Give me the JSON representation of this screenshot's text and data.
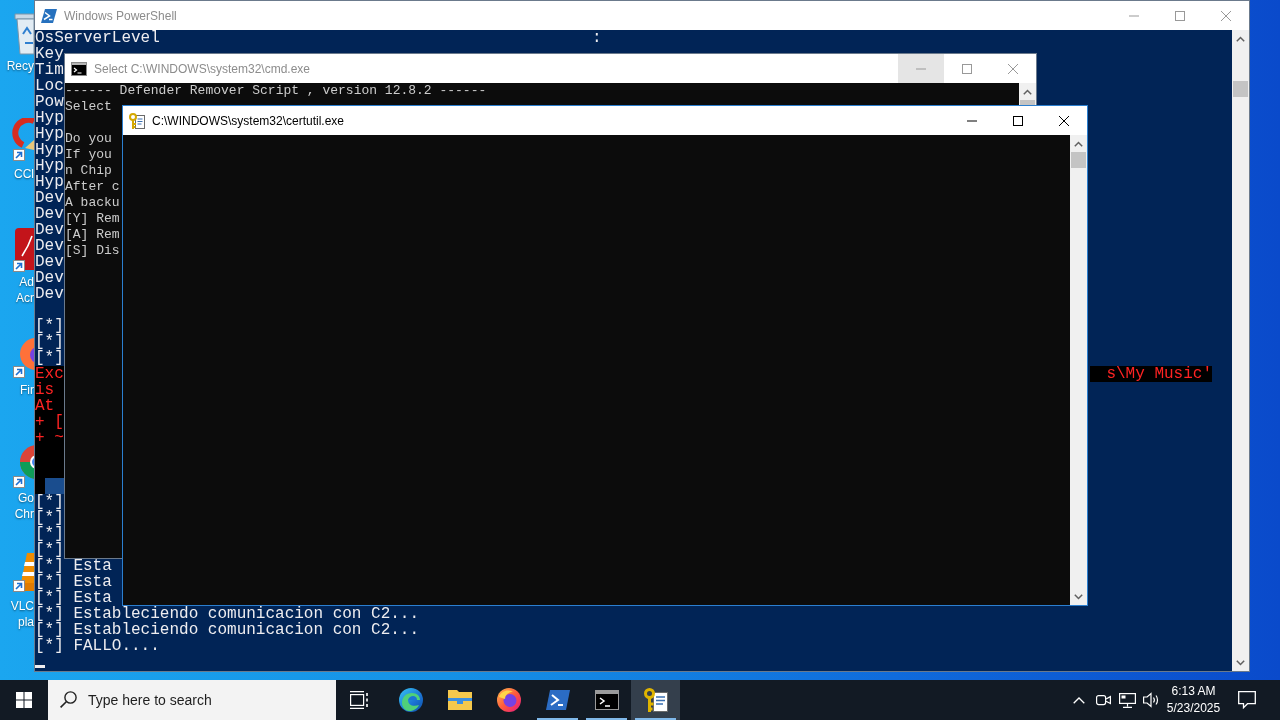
{
  "desktop": {
    "icons": [
      {
        "kind": "recycle_bin",
        "label": [
          "Recy"
        ]
      },
      {
        "kind": "cleaner",
        "label": [
          "CCl"
        ]
      },
      {
        "kind": "pdf_reader",
        "label": [
          "Ad",
          "Acr"
        ]
      },
      {
        "kind": "firefox",
        "label": [
          "Fir"
        ]
      },
      {
        "kind": "chrome",
        "label": [
          "Go",
          "Chr"
        ]
      },
      {
        "kind": "vlc",
        "label": [
          "VLC",
          "pla"
        ]
      }
    ]
  },
  "windows": [
    {
      "kind": "powershell",
      "title": "Windows PowerShell",
      "active": false,
      "controls": [
        {
          "kind": "minimize",
          "hovered": false
        },
        {
          "kind": "maximize",
          "hovered": false
        },
        {
          "kind": "close",
          "hovered": false
        }
      ],
      "lines": [
        {
          "kind": "text",
          "text": "OsServerLevel",
          "value": ":"
        },
        {
          "kind": "text",
          "text": "Key"
        },
        {
          "kind": "text",
          "text": "Tim"
        },
        {
          "kind": "text",
          "text": "Loc"
        },
        {
          "kind": "text",
          "text": "Pow"
        },
        {
          "kind": "text",
          "text": "Hyp"
        },
        {
          "kind": "text",
          "text": "Hyp"
        },
        {
          "kind": "text",
          "text": "Hyp"
        },
        {
          "kind": "text",
          "text": "Hyp"
        },
        {
          "kind": "text",
          "text": "Hyp"
        },
        {
          "kind": "text",
          "text": "Dev"
        },
        {
          "kind": "text",
          "text": "Dev"
        },
        {
          "kind": "text",
          "text": "Dev"
        },
        {
          "kind": "text",
          "text": "Dev"
        },
        {
          "kind": "text",
          "text": "Dev"
        },
        {
          "kind": "text",
          "text": "Dev"
        },
        {
          "kind": "text",
          "text": "Dev"
        },
        {
          "kind": "blank"
        },
        {
          "kind": "text",
          "text": "[*]"
        },
        {
          "kind": "text",
          "text": "[*]"
        },
        {
          "kind": "text",
          "text": "[*]"
        },
        {
          "kind": "error",
          "text": "Exc",
          "tail": "s\\My Music'"
        },
        {
          "kind": "error",
          "text": "is"
        },
        {
          "kind": "error",
          "text": "At"
        },
        {
          "kind": "error",
          "text": "+ ["
        },
        {
          "kind": "error",
          "text": "+ ~"
        },
        {
          "kind": "error"
        },
        {
          "kind": "error"
        },
        {
          "kind": "highlight"
        },
        {
          "kind": "text",
          "text": "[*]"
        },
        {
          "kind": "text",
          "text": "[*]"
        },
        {
          "kind": "text",
          "text": "[*]"
        },
        {
          "kind": "text",
          "text": "[*]"
        },
        {
          "kind": "text",
          "text": "[*] Esta"
        },
        {
          "kind": "text",
          "text": "[*] Esta"
        },
        {
          "kind": "text",
          "text": "[*] Esta"
        },
        {
          "kind": "text",
          "text": "[*] Estableciendo comunicacion con C2..."
        },
        {
          "kind": "text",
          "text": "[*] Estableciendo comunicacion con C2..."
        },
        {
          "kind": "text",
          "text": "[*] FALLO...."
        },
        {
          "kind": "cursor"
        }
      ]
    },
    {
      "kind": "cmd",
      "title": "Select C:\\WINDOWS\\system32\\cmd.exe",
      "active": false,
      "controls": [
        {
          "kind": "minimize",
          "hovered": true
        },
        {
          "kind": "maximize",
          "hovered": false
        },
        {
          "kind": "close",
          "hovered": false
        }
      ],
      "lines": [
        {
          "kind": "text",
          "text": "------ Defender Remover Script , version 12.8.2 ------"
        },
        {
          "kind": "text",
          "text": "Select"
        },
        {
          "kind": "blank"
        },
        {
          "kind": "text",
          "text": "Do you"
        },
        {
          "kind": "text",
          "text": "If you"
        },
        {
          "kind": "text",
          "text": "n Chip"
        },
        {
          "kind": "text",
          "text": "After c"
        },
        {
          "kind": "text",
          "text": "A backu"
        },
        {
          "kind": "text",
          "text": "[Y] Rem"
        },
        {
          "kind": "text",
          "text": "[A] Rem"
        },
        {
          "kind": "text",
          "text": "[S] Dis"
        }
      ]
    },
    {
      "kind": "certutil",
      "title": "C:\\WINDOWS\\system32\\certutil.exe",
      "active": true,
      "controls": [
        {
          "kind": "minimize",
          "hovered": false
        },
        {
          "kind": "maximize",
          "hovered": false
        },
        {
          "kind": "close",
          "hovered": false
        }
      ]
    }
  ],
  "taskbar": {
    "search": {
      "placeholder": "Type here to search"
    },
    "apps": [
      {
        "kind": "edge",
        "running": false,
        "selected": false
      },
      {
        "kind": "file_explorer",
        "running": false,
        "selected": false
      },
      {
        "kind": "firefox",
        "running": false,
        "selected": false
      },
      {
        "kind": "powershell",
        "running": true,
        "selected": false
      },
      {
        "kind": "cmd",
        "running": true,
        "selected": false
      },
      {
        "kind": "certutil",
        "running": true,
        "selected": true
      }
    ],
    "tray": [
      {
        "kind": "chevron"
      },
      {
        "kind": "meet_now"
      },
      {
        "kind": "network"
      },
      {
        "kind": "volume"
      }
    ],
    "time": "6:13 AM",
    "date": "5/23/2025"
  }
}
